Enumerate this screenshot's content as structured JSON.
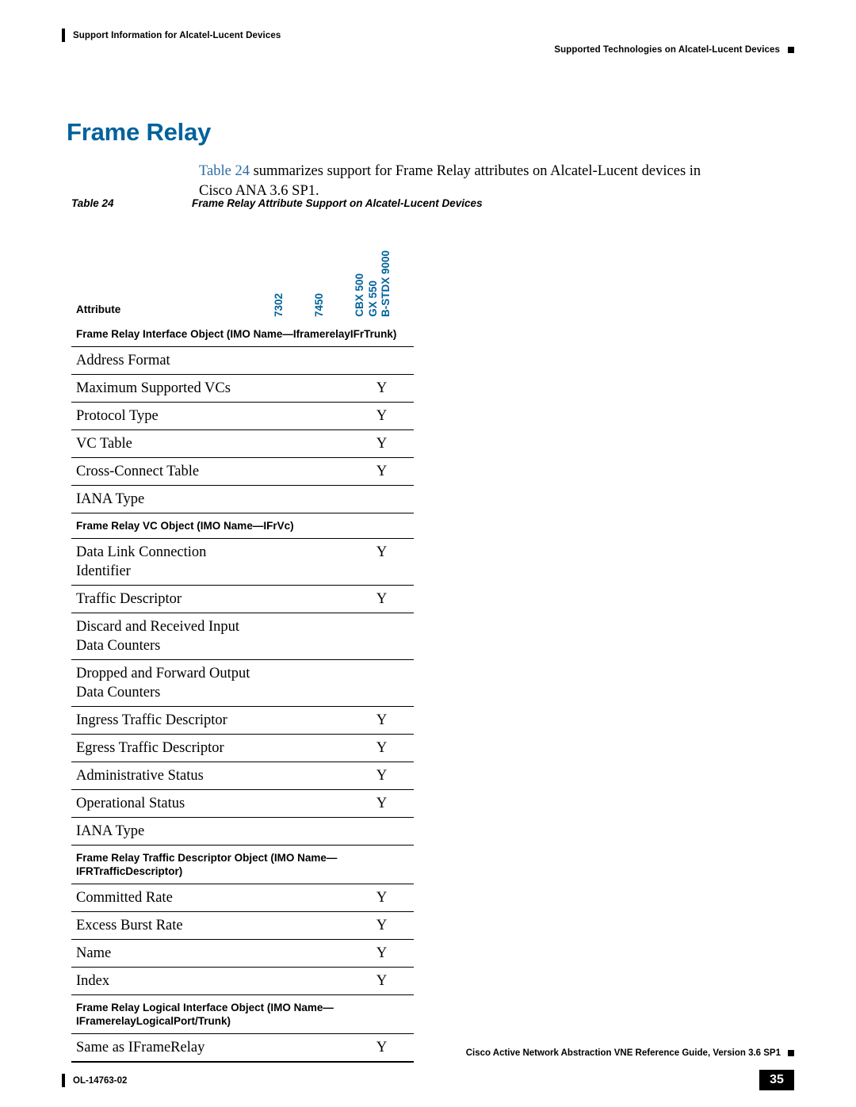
{
  "header": {
    "left": "Support Information for Alcatel-Lucent Devices",
    "right": "Supported Technologies on Alcatel-Lucent Devices"
  },
  "title": "Frame Relay",
  "intro": {
    "xref": "Table 24",
    "rest": " summarizes support for Frame Relay attributes on Alcatel-Lucent devices in Cisco ANA 3.6 SP1."
  },
  "caption": {
    "number": "Table 24",
    "text": "Frame Relay Attribute Support on Alcatel-Lucent Devices"
  },
  "table": {
    "columns": {
      "attribute": "Attribute",
      "c1": "7302",
      "c2": "7450",
      "c3a": "CBX 500",
      "c3b": "GX 550",
      "c3c": "B-STDX 9000"
    },
    "accent_color": "#00629B",
    "sections": [
      {
        "heading": "Frame Relay Interface Object (IMO Name—IframerelayIFrTrunk)",
        "rows": [
          {
            "attribute": "Address Format",
            "c1": "",
            "c2": "",
            "c3": ""
          },
          {
            "attribute": "Maximum Supported VCs",
            "c1": "",
            "c2": "",
            "c3": "Y"
          },
          {
            "attribute": "Protocol Type",
            "c1": "",
            "c2": "",
            "c3": "Y"
          },
          {
            "attribute": "VC Table",
            "c1": "",
            "c2": "",
            "c3": "Y"
          },
          {
            "attribute": "Cross-Connect Table",
            "c1": "",
            "c2": "",
            "c3": "Y"
          },
          {
            "attribute": "IANA Type",
            "c1": "",
            "c2": "",
            "c3": ""
          }
        ]
      },
      {
        "heading": "Frame Relay VC Object (IMO Name—IFrVc)",
        "rows": [
          {
            "attribute": "Data Link Connection Identifier",
            "c1": "",
            "c2": "",
            "c3": "Y"
          },
          {
            "attribute": "Traffic Descriptor",
            "c1": "",
            "c2": "",
            "c3": "Y"
          },
          {
            "attribute": "Discard and Received Input Data Counters",
            "c1": "",
            "c2": "",
            "c3": ""
          },
          {
            "attribute": "Dropped and Forward Output Data Counters",
            "c1": "",
            "c2": "",
            "c3": ""
          },
          {
            "attribute": "Ingress Traffic Descriptor",
            "c1": "",
            "c2": "",
            "c3": "Y"
          },
          {
            "attribute": "Egress Traffic Descriptor",
            "c1": "",
            "c2": "",
            "c3": "Y"
          },
          {
            "attribute": "Administrative Status",
            "c1": "",
            "c2": "",
            "c3": "Y"
          },
          {
            "attribute": "Operational Status",
            "c1": "",
            "c2": "",
            "c3": "Y"
          },
          {
            "attribute": "IANA Type",
            "c1": "",
            "c2": "",
            "c3": ""
          }
        ]
      },
      {
        "heading": "Frame Relay Traffic Descriptor Object (IMO Name—IFRTrafficDescriptor)",
        "rows": [
          {
            "attribute": "Committed Rate",
            "c1": "",
            "c2": "",
            "c3": "Y"
          },
          {
            "attribute": "Excess Burst Rate",
            "c1": "",
            "c2": "",
            "c3": "Y"
          },
          {
            "attribute": "Name",
            "c1": "",
            "c2": "",
            "c3": "Y"
          },
          {
            "attribute": "Index",
            "c1": "",
            "c2": "",
            "c3": "Y"
          }
        ]
      },
      {
        "heading": "Frame Relay Logical Interface Object (IMO Name—IFramerelayLogicalPort/Trunk)",
        "rows": [
          {
            "attribute": "Same as IFrameRelay",
            "c1": "",
            "c2": "",
            "c3": "Y"
          }
        ]
      }
    ]
  },
  "footer": {
    "right": "Cisco Active Network Abstraction VNE Reference Guide, Version 3.6 SP1",
    "left": "OL-14763-02",
    "page": "35"
  }
}
